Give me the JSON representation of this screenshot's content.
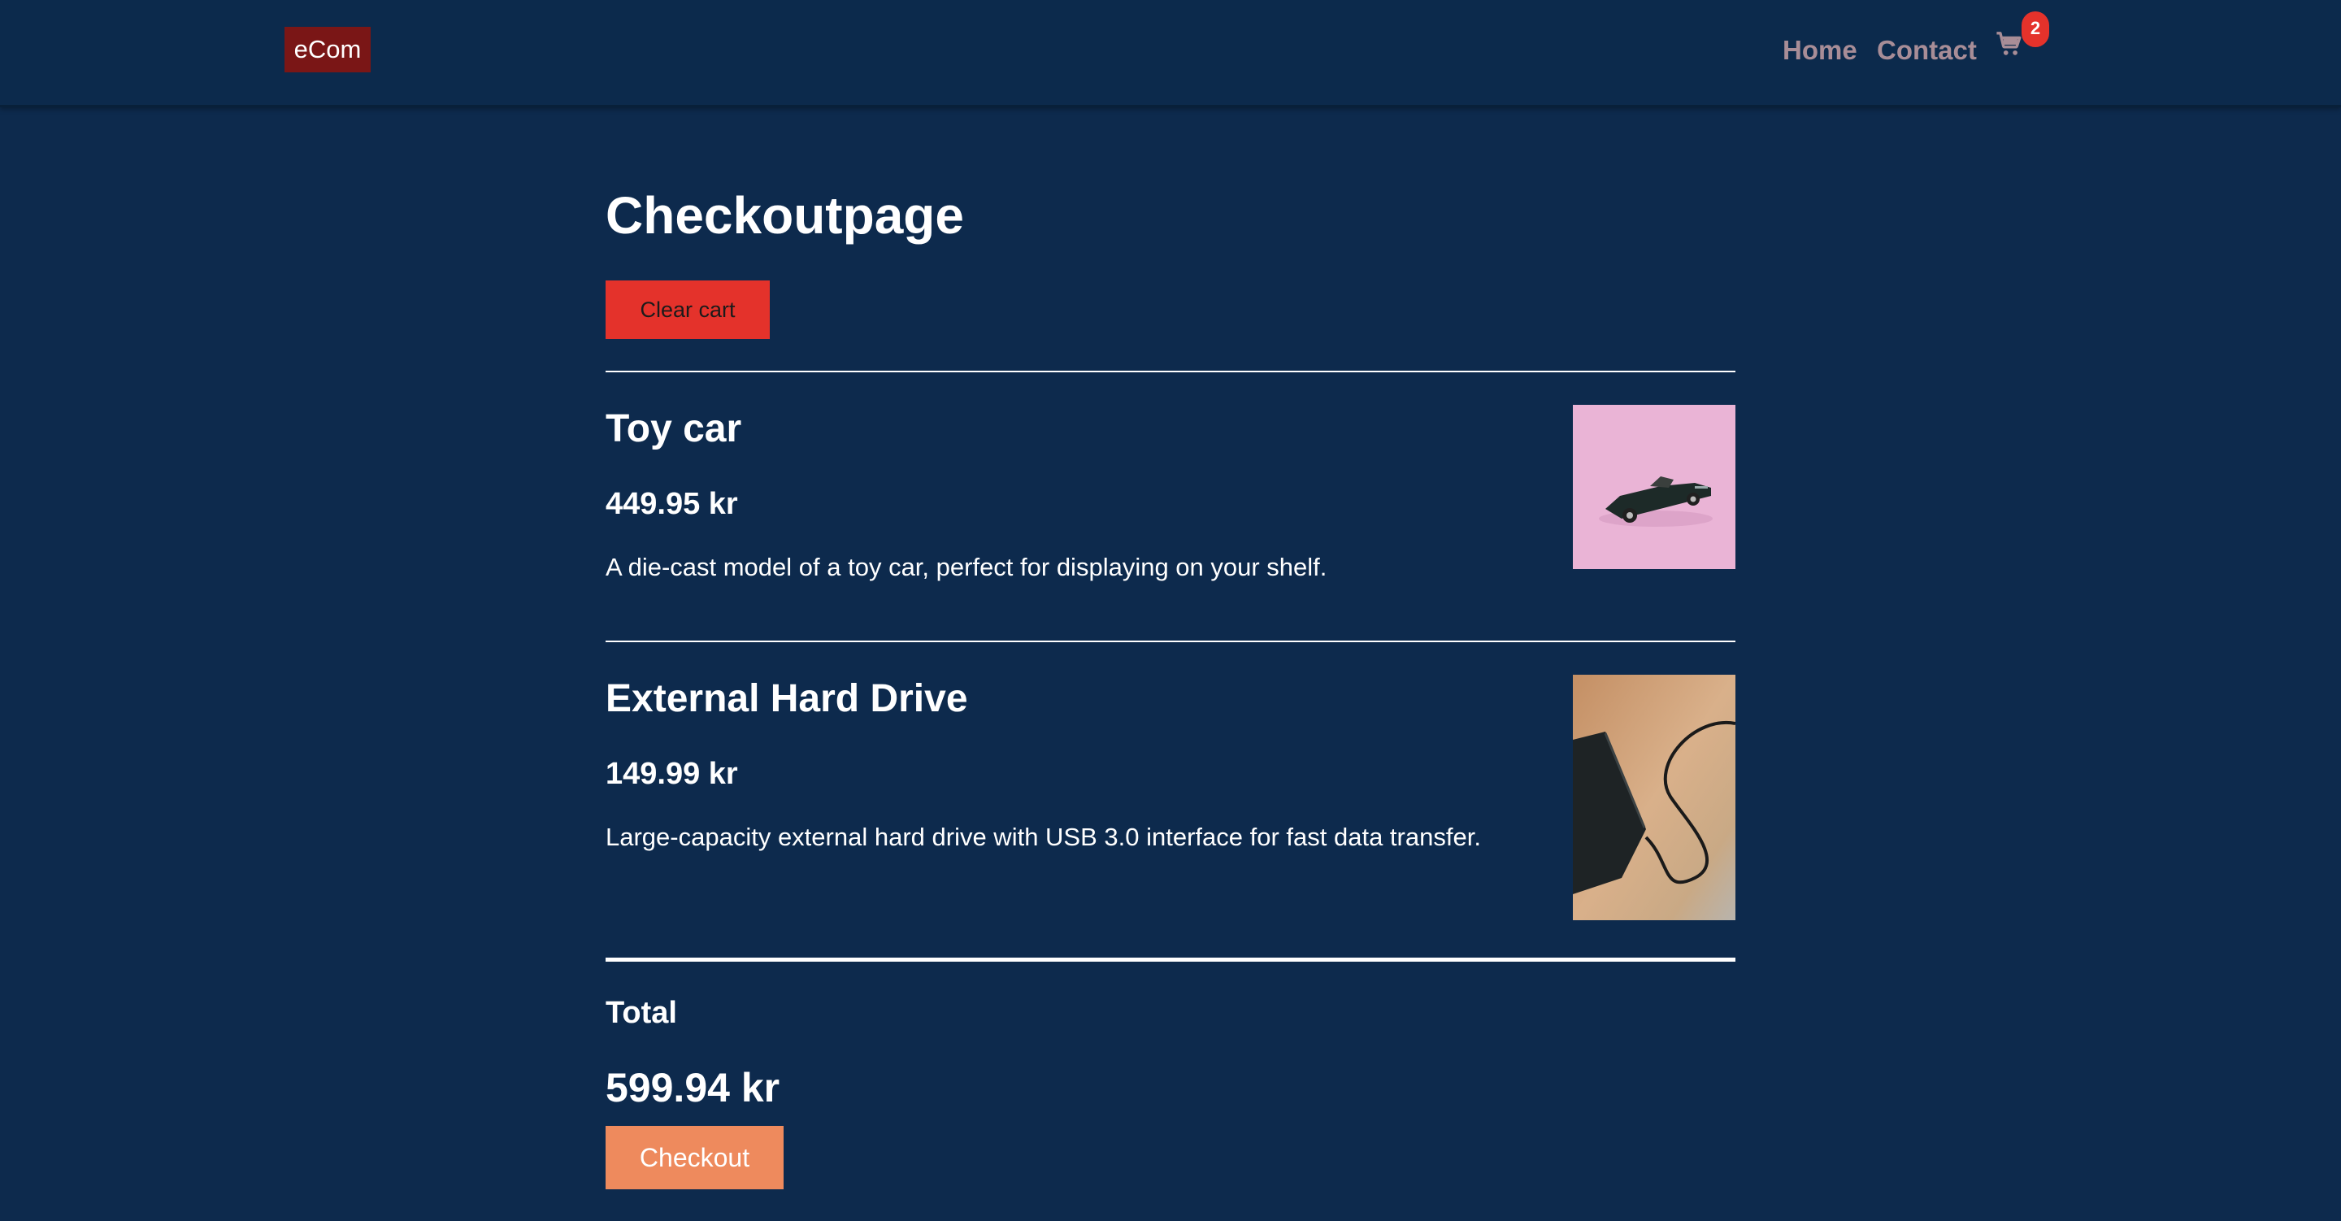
{
  "header": {
    "logo": "eCom",
    "nav": [
      {
        "label": "Home"
      },
      {
        "label": "Contact"
      }
    ],
    "cart_icon": "shopping-cart-icon",
    "cart_count": "2"
  },
  "main": {
    "title": "Checkoutpage",
    "clear_cart_label": "Clear cart",
    "items": [
      {
        "name": "Toy car",
        "price": "449.95 kr",
        "description": "A die-cast model of a toy car, perfect for displaying on your shelf."
      },
      {
        "name": "External Hard Drive",
        "price": "149.99 kr",
        "description": "Large-capacity external hard drive with USB 3.0 interface for fast data transfer."
      }
    ],
    "total_label": "Total",
    "total_value": "599.94 kr",
    "checkout_label": "Checkout"
  },
  "colors": {
    "background": "#0d2a4d",
    "logo_bg": "#7a1616",
    "nav_link": "#a88d97",
    "clear_button": "#e4322b",
    "badge": "#e4322b",
    "checkout_button": "#ee8a5d"
  }
}
